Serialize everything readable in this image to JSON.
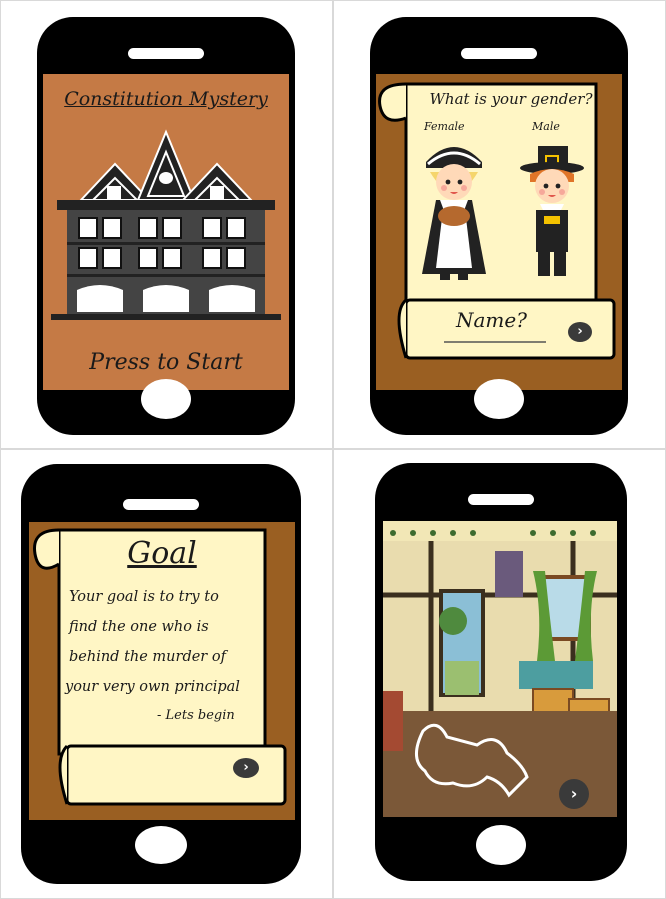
{
  "screen1": {
    "title": "Constitution Mystery",
    "start_label": "Press to Start"
  },
  "screen2": {
    "question": "What is your gender?",
    "female_label": "Female",
    "male_label": "Male",
    "name_label": "Name?"
  },
  "screen3": {
    "heading": "Goal",
    "lines": [
      "Your goal is to try to",
      "find the one who is",
      "behind the murder of",
      "your very own principal"
    ],
    "sign_off": "- Lets begin"
  },
  "screen4": {
    "scene": "classroom crime scene"
  },
  "icons": {
    "next": "chevron-right-icon"
  },
  "colors": {
    "phone": "#000000",
    "screen1_bg": "#c57a45",
    "scroll": "#fff6c5",
    "wood": "#9a5f22"
  }
}
